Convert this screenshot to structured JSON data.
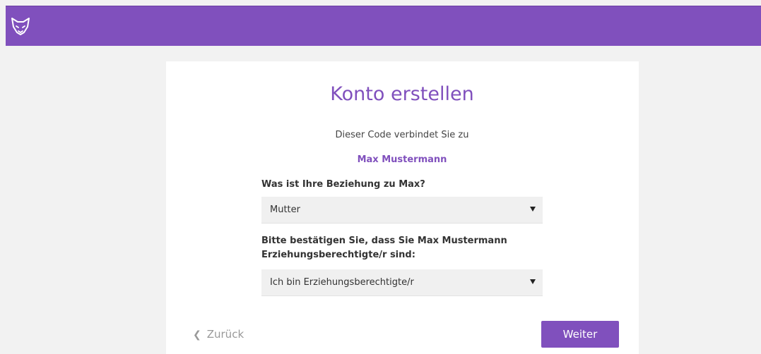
{
  "brand": {
    "icon": "fox-logo-icon",
    "color": "#8050bd"
  },
  "form": {
    "title": "Konto erstellen",
    "subtitle": "Dieser Code verbindet Sie zu",
    "child_name": "Max Mustermann",
    "relationship": {
      "label": "Was ist Ihre Beziehung zu Max?",
      "selected": "Mutter"
    },
    "guardian": {
      "label_line1": "Bitte bestätigen Sie, dass Sie Max Mustermann",
      "label_line2": "Erziehungsberechtigte/r sind:",
      "selected": "Ich bin Erziehungsberechtigte/r"
    }
  },
  "nav": {
    "back_label": "Zurück",
    "next_label": "Weiter"
  }
}
